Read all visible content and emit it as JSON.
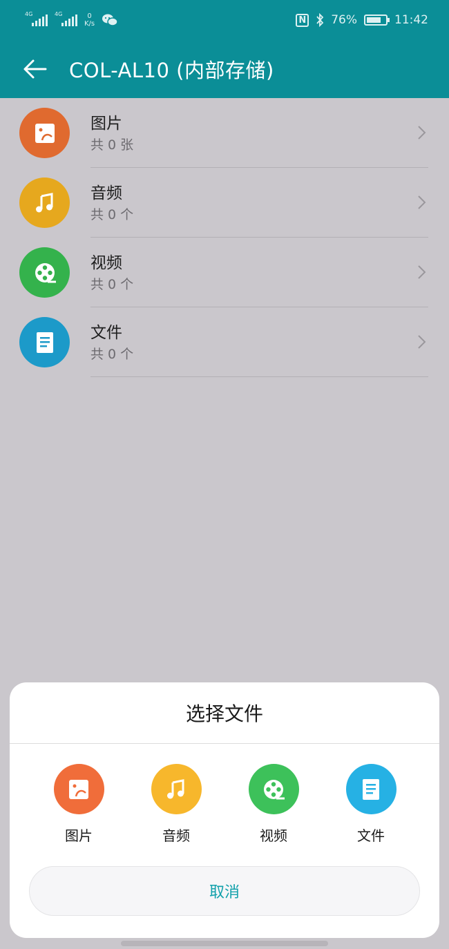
{
  "status_bar": {
    "signal1_tag": "4G",
    "signal2_tag": "4G",
    "speed_value": "0",
    "speed_unit": "K/s",
    "nfc_label": "N",
    "battery_pct": "76%",
    "battery_level": 0.76,
    "time": "11:42"
  },
  "app_bar": {
    "title": "COL-AL10 (内部存储)"
  },
  "categories": [
    {
      "name": "图片",
      "count": "共 0 张",
      "icon": "image-icon",
      "color": "#e06a2f"
    },
    {
      "name": "音频",
      "count": "共 0 个",
      "icon": "music-note-icon",
      "color": "#e6a81e"
    },
    {
      "name": "视频",
      "count": "共 0 个",
      "icon": "film-reel-icon",
      "color": "#34b24c"
    },
    {
      "name": "文件",
      "count": "共 0 个",
      "icon": "document-icon",
      "color": "#1c9ac9"
    }
  ],
  "sheet": {
    "title": "选择文件",
    "options": [
      {
        "label": "图片",
        "icon": "image-icon",
        "color": "#f06d3a"
      },
      {
        "label": "音频",
        "icon": "music-note-icon",
        "color": "#f7b72c"
      },
      {
        "label": "视频",
        "icon": "film-reel-icon",
        "color": "#3dc15a"
      },
      {
        "label": "文件",
        "icon": "document-icon",
        "color": "#26b1e4"
      }
    ],
    "cancel_label": "取消"
  },
  "colors": {
    "accent": "#0b8e97",
    "cancel_text": "#12a1ab"
  }
}
